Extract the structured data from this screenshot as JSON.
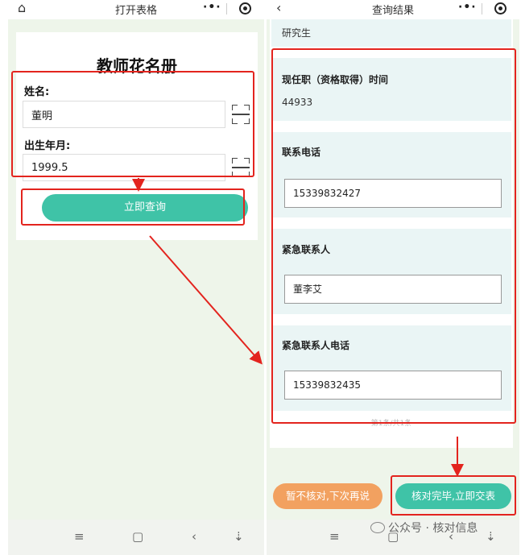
{
  "left_screen": {
    "topbar": {
      "title": "打开表格",
      "home_icon": "home-icon"
    },
    "form": {
      "title": "教师花名册",
      "name_label": "姓名:",
      "name_value": "董明",
      "birth_label": "出生年月:",
      "birth_value": "1999.5",
      "query_button": "立即查询"
    }
  },
  "right_screen": {
    "topbar": {
      "title": "查询结果",
      "back_icon": "back-arrow-icon"
    },
    "result": {
      "degree_value": "研究生",
      "position_time_label": "现任职（资格取得）时间",
      "position_time_value": "44933",
      "phone_label": "联系电话",
      "phone_value": "15339832427",
      "emergency_contact_label": "紧急联系人",
      "emergency_contact_value": "董李艾",
      "emergency_phone_label": "紧急联系人电话",
      "emergency_phone_value": "15339832435",
      "pagination": "第1条/共1条"
    },
    "actions": {
      "defer_button": "暂不核对,下次再说",
      "confirm_button": "核对完毕,立即交表"
    }
  },
  "system_nav": {
    "menu": "≡",
    "home": "▢",
    "back": "‹",
    "down": "⇣"
  },
  "watermark": "公众号 · 核对信息",
  "colors": {
    "accent_green": "#3fc3a7",
    "accent_orange": "#f2a160",
    "annotation_red": "#e3241e",
    "background": "#eef5ea"
  }
}
